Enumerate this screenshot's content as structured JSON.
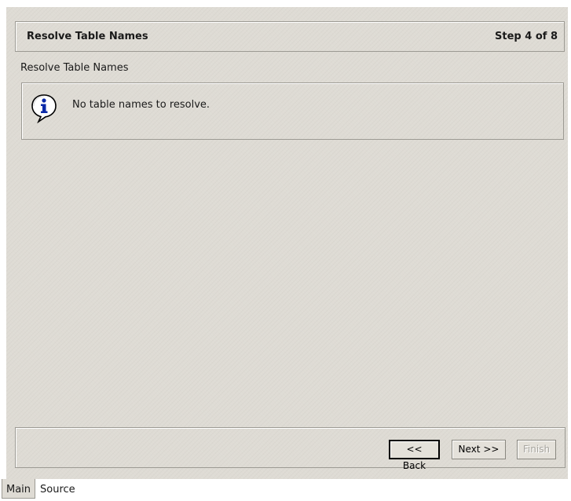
{
  "wizard": {
    "title": "Resolve Table Names",
    "step": "Step 4 of 8",
    "section_label": "Resolve Table Names",
    "message": "No table names to resolve.",
    "message_icon": "info-bubble-icon"
  },
  "buttons": {
    "back": "<< Back",
    "next": "Next >>",
    "finish": "Finish"
  },
  "tabs": [
    {
      "label": "Main",
      "selected": true
    },
    {
      "label": "Source",
      "selected": false
    }
  ]
}
